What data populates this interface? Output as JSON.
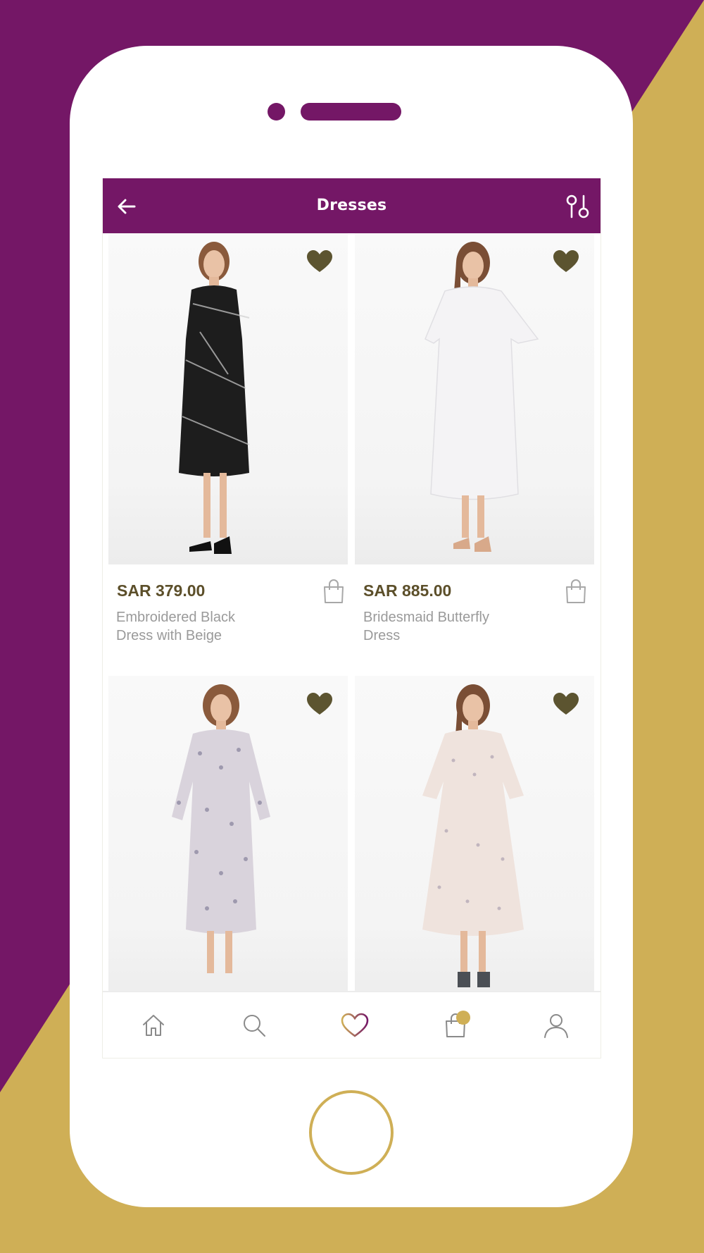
{
  "colors": {
    "brand_purple": "#741766",
    "brand_gold": "#CFAF56",
    "heart_olive": "#5c5430",
    "price_brown": "#5c4f2a",
    "name_gray": "#9a9a9a"
  },
  "header": {
    "title": "Dresses",
    "back_icon": "arrow-left-icon",
    "filter_icon": "filter-sliders-icon"
  },
  "products": [
    {
      "price": "SAR 379.00",
      "name_line1": "Embroidered Black",
      "name_line2": "Dress with Beige",
      "favorited": true,
      "dress_color": "#1d1d1d"
    },
    {
      "price": "SAR 885.00",
      "name_line1": "Bridesmaid Butterfly",
      "name_line2": "Dress",
      "favorited": true,
      "dress_color": "#f4f3f5"
    },
    {
      "price": "",
      "name_line1": "",
      "name_line2": "",
      "favorited": true,
      "dress_color": "#d9d3dc"
    },
    {
      "price": "",
      "name_line1": "",
      "name_line2": "",
      "favorited": true,
      "dress_color": "#efe3dd"
    }
  ],
  "tabbar": {
    "items": [
      {
        "icon": "home-icon",
        "active": false
      },
      {
        "icon": "search-icon",
        "active": false
      },
      {
        "icon": "heart-icon",
        "active": true
      },
      {
        "icon": "shopping-bag-icon",
        "active": false,
        "badge": true
      },
      {
        "icon": "user-icon",
        "active": false
      }
    ]
  }
}
